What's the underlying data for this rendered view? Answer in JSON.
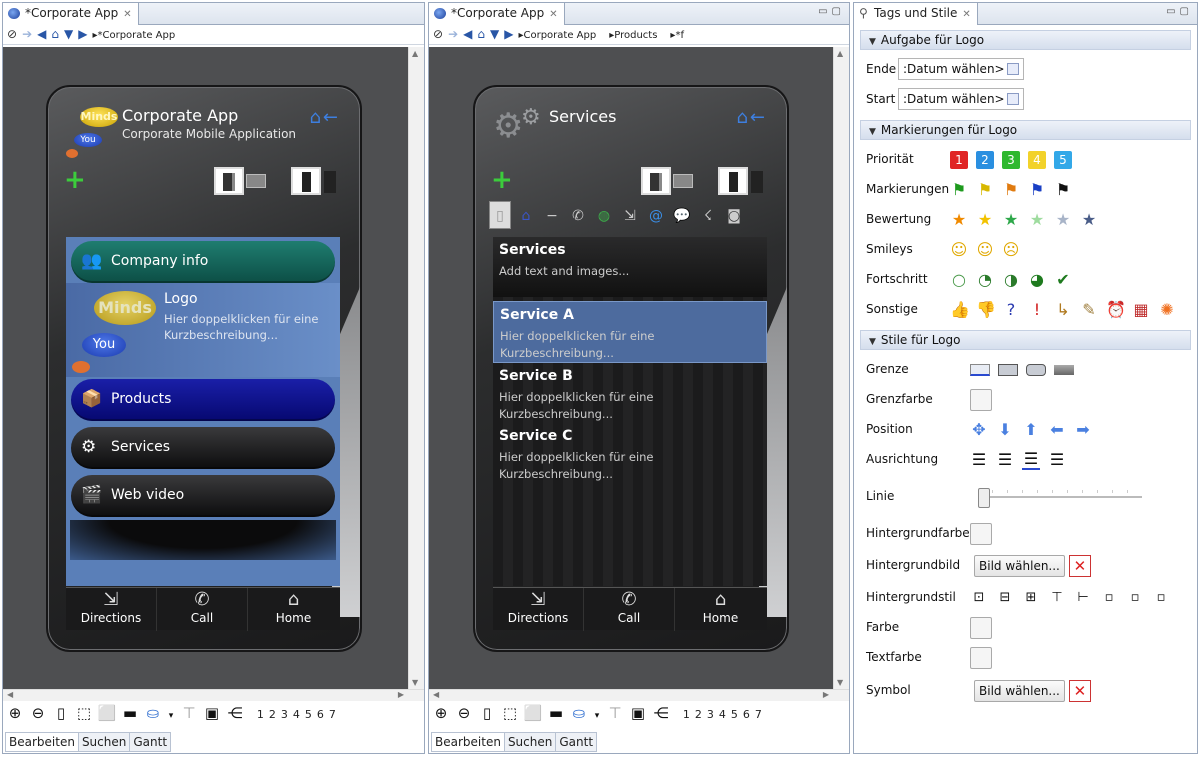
{
  "left_editor": {
    "tab_title": "*Corporate App",
    "breadcrumb": [
      "*Corporate App"
    ],
    "phone": {
      "title": "Corporate App",
      "subtitle": "Corporate Mobile Application",
      "logo_minds": "Minds",
      "logo_you": "You",
      "menu": {
        "company_info": "Company info",
        "logo_title": "Logo",
        "logo_desc": "Hier doppelklicken für eine Kurzbeschreibung...",
        "logo_minds": "Minds",
        "logo_you": "You",
        "products": "Products",
        "services": "Services",
        "web_video": "Web video"
      },
      "bottom_nav": [
        "Directions",
        "Call",
        "Home"
      ]
    },
    "page_numbers": [
      "1",
      "2",
      "3",
      "4",
      "5",
      "6",
      "7"
    ],
    "bottom_tabs": [
      "Bearbeiten",
      "Suchen",
      "Gantt"
    ]
  },
  "middle_editor": {
    "tab_title": "*Corporate App",
    "breadcrumb": [
      "Corporate App",
      "Products",
      "*f"
    ],
    "phone": {
      "title": "Services",
      "header_title": "Services",
      "header_desc": "Add text and images...",
      "items": [
        {
          "title": "Service A",
          "desc": "Hier doppelklicken für eine Kurzbeschreibung..."
        },
        {
          "title": "Service B",
          "desc": "Hier doppelklicken für eine Kurzbeschreibung..."
        },
        {
          "title": "Service C",
          "desc": "Hier doppelklicken für eine Kurzbeschreibung..."
        }
      ],
      "bottom_nav": [
        "Directions",
        "Call",
        "Home"
      ]
    },
    "page_numbers": [
      "1",
      "2",
      "3",
      "4",
      "5",
      "6",
      "7"
    ],
    "bottom_tabs": [
      "Bearbeiten",
      "Suchen",
      "Gantt"
    ]
  },
  "right_panel": {
    "tab_title": "Tags und Stile",
    "sections": {
      "task": "Aufgabe für Logo",
      "markers": "Markierungen für Logo",
      "styles": "Stile für Logo"
    },
    "task": {
      "end_label": "Ende",
      "end_value": ":Datum wählen>",
      "start_label": "Start",
      "start_value": ":Datum wählen>"
    },
    "markers": {
      "priority_label": "Priorität",
      "priorities": [
        "1",
        "2",
        "3",
        "4",
        "5"
      ],
      "priority_colors": [
        "#e02424",
        "#2a8fe0",
        "#2fb82f",
        "#f2d22a",
        "#33a8e8"
      ],
      "flags_label": "Markierungen",
      "rating_label": "Bewertung",
      "smileys_label": "Smileys",
      "progress_label": "Fortschritt",
      "other_label": "Sonstige"
    },
    "styles": {
      "border": "Grenze",
      "border_color": "Grenzfarbe",
      "position": "Position",
      "alignment": "Ausrichtung",
      "line": "Linie",
      "bg_color": "Hintergrundfarbe",
      "bg_image": "Hintergrundbild",
      "bg_image_button": "Bild wählen...",
      "bg_style": "Hintergrundstil",
      "color": "Farbe",
      "text_color": "Textfarbe",
      "symbol": "Symbol",
      "symbol_button": "Bild wählen..."
    }
  }
}
